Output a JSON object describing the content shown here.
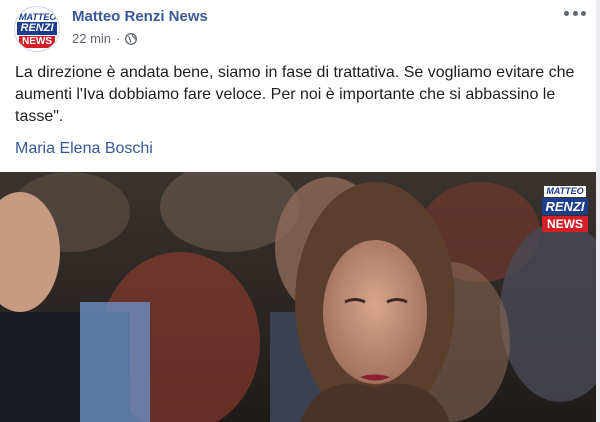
{
  "post": {
    "page_name": "Matteo Renzi News",
    "time": "22 min",
    "separator": "·",
    "privacy_icon": "globe-icon",
    "more_icon": "more-options-icon",
    "text": "La direzione è andata bene, siamo in fase di trattativa. Se vogliamo evitare che aumenti l'Iva dobbiamo fare veloce. Per noi è importante che si abbassino le tasse\".",
    "author": "Maria Elena Boschi"
  },
  "logo": {
    "line1": "MATTEO",
    "line2": "RENZI",
    "line3": "NEWS"
  },
  "colors": {
    "link": "#385898",
    "brand_blue": "#1c3d8c",
    "brand_red": "#d32027",
    "meta_text": "#616770"
  }
}
